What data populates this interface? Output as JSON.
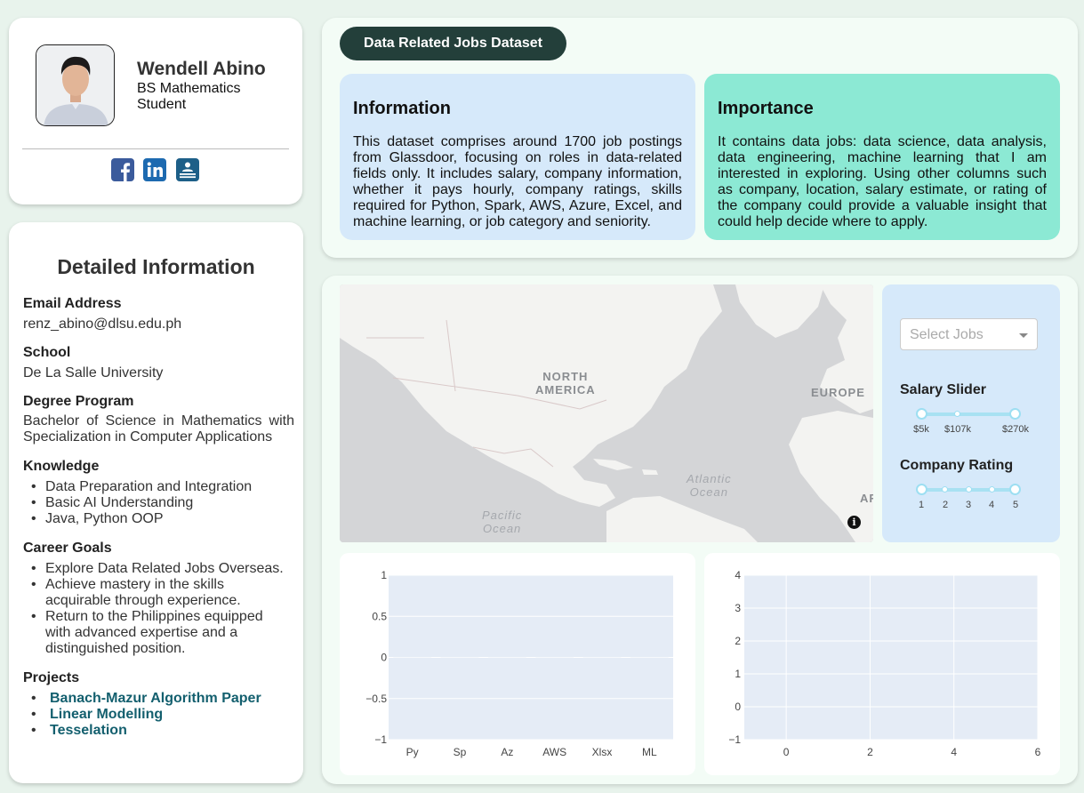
{
  "profile": {
    "name": "Wendell Abino",
    "role": "BS Mathematics Student",
    "social": [
      "facebook-icon",
      "linkedin-icon",
      "resume-icon"
    ]
  },
  "details": {
    "title": "Detailed Information",
    "email_label": "Email Address",
    "email": "renz_abino@dlsu.edu.ph",
    "school_label": "School",
    "school": "De La Salle University",
    "degree_label": "Degree Program",
    "degree": "Bachelor of Science in Mathematics with Specialization in Computer Applications",
    "knowledge_label": "Knowledge",
    "knowledge": [
      "Data Preparation and Integration",
      "Basic AI Understanding",
      "Java, Python OOP"
    ],
    "goals_label": "Career Goals",
    "goals": [
      "Explore Data Related Jobs Overseas.",
      "Achieve mastery in the skills acquirable through experience.",
      "Return to the Philippines equipped with advanced expertise and a distinguished position."
    ],
    "projects_label": "Projects",
    "projects": [
      "Banach-Mazur Algorithm Paper",
      "Linear Modelling",
      "Tesselation"
    ]
  },
  "dataset": {
    "title": "Data Related Jobs Dataset",
    "info_title": "Information",
    "info_text": "This dataset comprises around 1700 job postings from Glassdoor, focusing on roles in data-related fields only. It includes salary, company information, whether it pays hourly, company ratings, skills required for Python, Spark, AWS, Azure, Excel, and machine learning, or job category and seniority.",
    "importance_title": "Importance",
    "importance_text": "It contains data jobs: data science, data analysis, data engineering, machine learning that I am interested in exploring. Using other columns such as company, location, salary estimate, or rating of the company could provide a valuable insight that could help decide where to apply.",
    "colors": {
      "dark": "#233f3a",
      "blue": "#d6e9fa",
      "teal": "#8ce9d4"
    }
  },
  "map": {
    "labels": {
      "north_america": "NORTH\nAMERICA",
      "europe": "EUROPE",
      "atlantic": "Atlantic\nOcean",
      "pacific": "Pacific\nOcean",
      "africa_partial": "AF"
    },
    "info_icon": "i"
  },
  "controls": {
    "select_placeholder": "Select Jobs",
    "salary_label": "Salary Slider",
    "salary_marks": [
      "$5k",
      "$107k",
      "$270k"
    ],
    "salary_range": [
      5,
      270
    ],
    "rating_label": "Company Rating",
    "rating_marks": [
      "1",
      "2",
      "3",
      "4",
      "5"
    ],
    "rating_range": [
      1,
      5
    ]
  },
  "chart_data": [
    {
      "type": "bar",
      "title": "",
      "categories": [
        "Py",
        "Sp",
        "Az",
        "AWS",
        "Xlsx",
        "ML"
      ],
      "values": [
        0,
        0,
        0,
        0,
        0,
        0
      ],
      "ylim": [
        -1,
        1
      ],
      "yticks": [
        "1",
        "0.5",
        "0",
        "−0.5",
        "−1"
      ],
      "grid": true
    },
    {
      "type": "scatter",
      "title": "",
      "x": [],
      "y": [],
      "xlim": [
        -1,
        6
      ],
      "ylim": [
        -1,
        4
      ],
      "xticks": [
        "0",
        "2",
        "4",
        "6"
      ],
      "yticks": [
        "4",
        "3",
        "2",
        "1",
        "0",
        "−1"
      ],
      "grid": true
    }
  ]
}
